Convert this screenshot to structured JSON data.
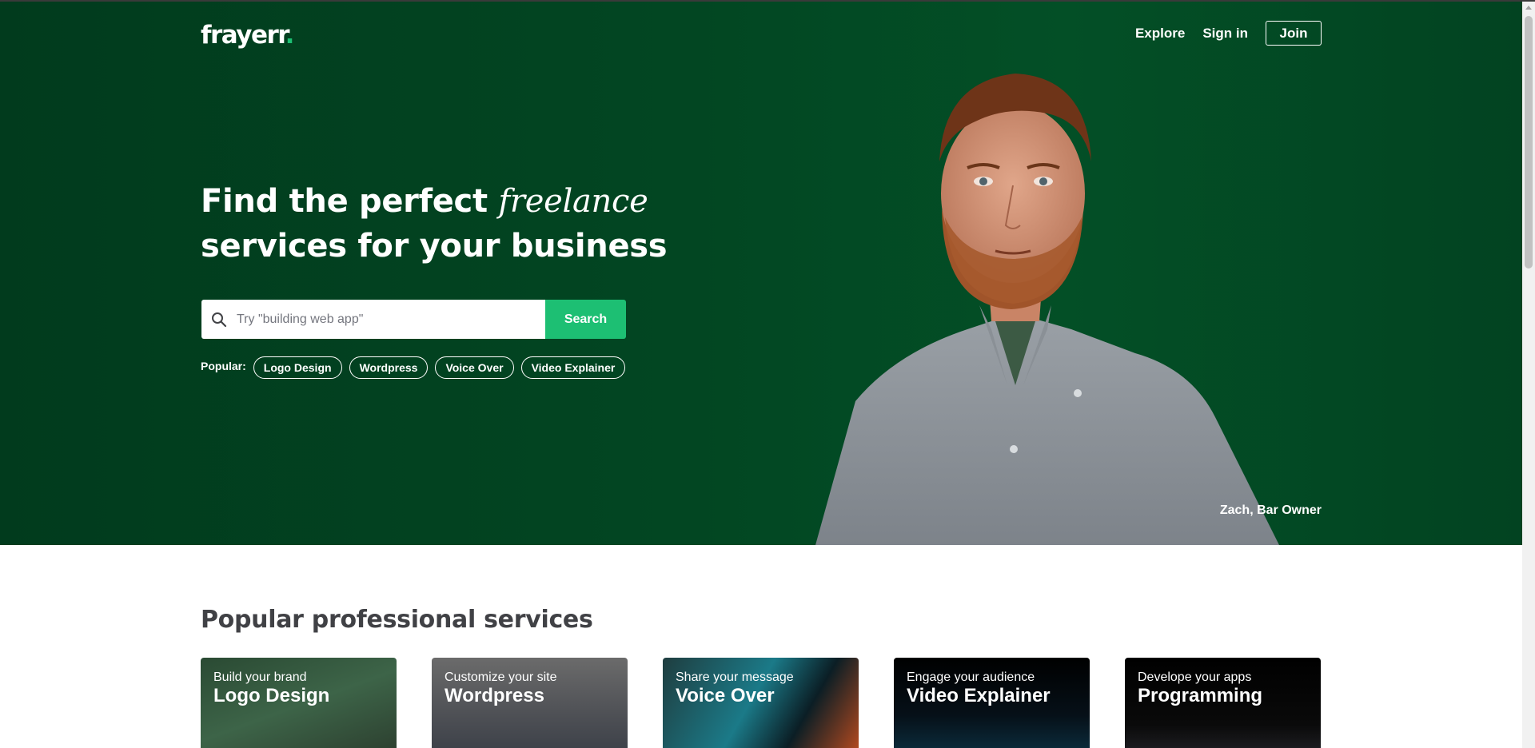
{
  "brand": {
    "logo_text": "frayerr",
    "logo_dot": ".",
    "accent_color": "#1dbf73",
    "hero_color": "#024622"
  },
  "nav": {
    "explore": "Explore",
    "sign_in": "Sign in",
    "join": "Join"
  },
  "hero": {
    "headline_part1": "Find the perfect ",
    "headline_italic": "freelance",
    "headline_line2": "services for your business",
    "search_placeholder": "Try \"building web app\"",
    "search_button": "Search",
    "popular_label": "Popular:",
    "popular_tags": [
      "Logo Design",
      "Wordpress",
      "Voice Over",
      "Video Explainer"
    ],
    "caption": "Zach, Bar Owner"
  },
  "section": {
    "title": "Popular professional services",
    "cards": [
      {
        "subtitle": "Build your brand",
        "title": "Logo Design"
      },
      {
        "subtitle": "Customize your site",
        "title": "Wordpress"
      },
      {
        "subtitle": "Share your message",
        "title": "Voice Over"
      },
      {
        "subtitle": "Engage your audience",
        "title": "Video Explainer"
      },
      {
        "subtitle": "Develope your apps",
        "title": "Programming"
      }
    ]
  },
  "icons": {
    "search": "search-icon"
  }
}
